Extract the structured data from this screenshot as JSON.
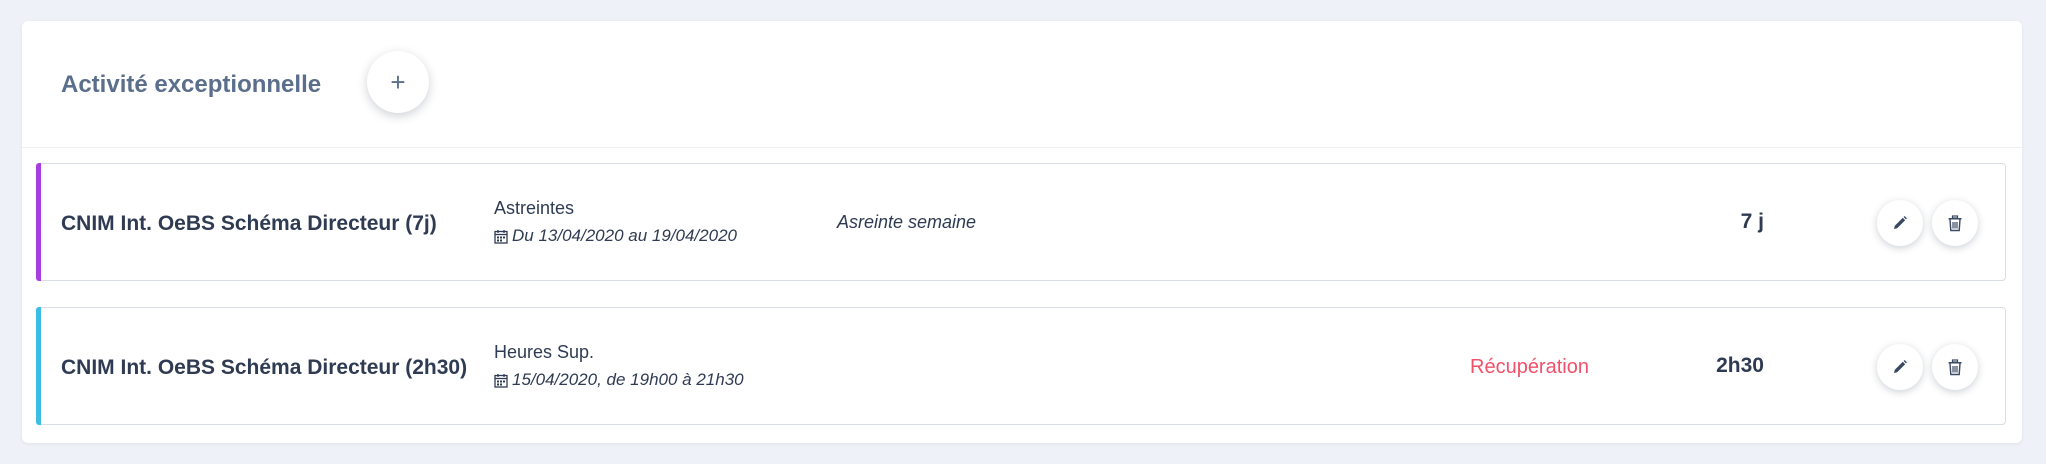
{
  "panel": {
    "title": "Activité exceptionnelle",
    "add_label": "+"
  },
  "rows": [
    {
      "project": "CNIM Int. OeBS Schéma Directeur (7j)",
      "type": "Astreintes",
      "dates": "Du 13/04/2020 au 19/04/2020",
      "comment": "Asreinte semaine",
      "status": "",
      "duration": "7 j",
      "accent_color": "#a93ee0"
    },
    {
      "project": "CNIM Int. OeBS Schéma Directeur (2h30)",
      "type": "Heures Sup.",
      "dates": "15/04/2020, de 19h00 à 21h30",
      "comment": "",
      "status": "Récupération",
      "duration": "2h30",
      "accent_color": "#3bbde6"
    }
  ],
  "icons": {
    "add": "plus-icon",
    "calendar": "calendar-icon",
    "edit": "pencil-icon",
    "delete": "trash-icon"
  },
  "colors": {
    "status_recuperation": "#f2506a",
    "title": "#5b6f8c"
  }
}
